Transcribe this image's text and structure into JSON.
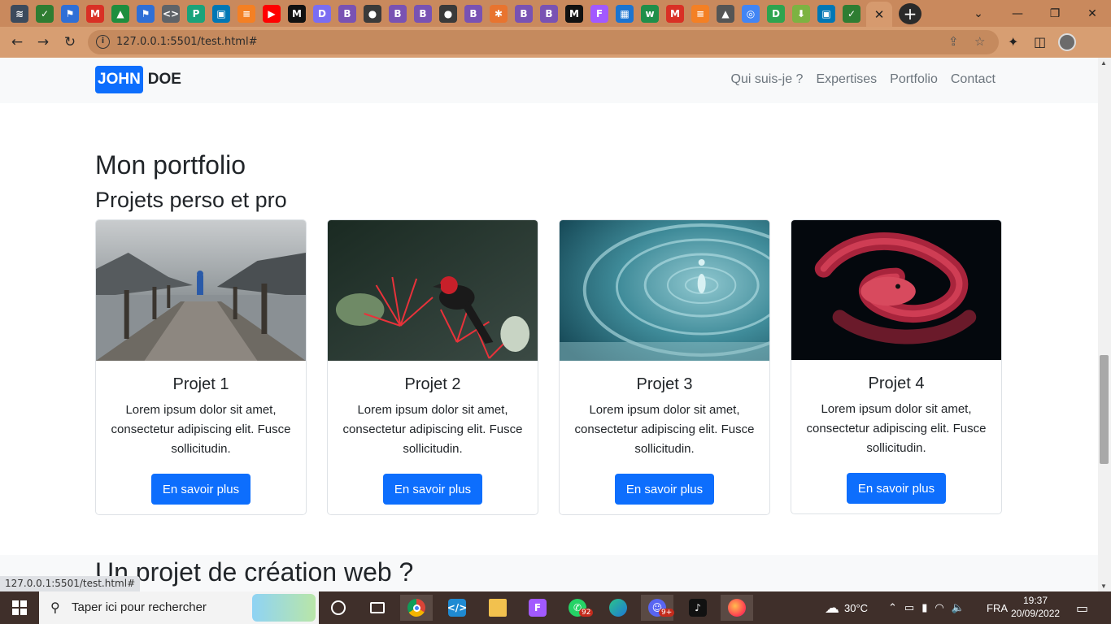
{
  "browser": {
    "url": "127.0.0.1:5501/test.html#",
    "status_url": "127.0.0.1:5501/test.html#",
    "tab_icons": [
      {
        "name": "layers-icon",
        "glyph": "≋",
        "color": "#3c4a5c"
      },
      {
        "name": "app-icon",
        "glyph": "✓",
        "color": "#2e7d32"
      },
      {
        "name": "flag-icon",
        "glyph": "⚑",
        "color": "#2f6fd6"
      },
      {
        "name": "gmail-icon",
        "glyph": "M",
        "color": "#d93025"
      },
      {
        "name": "drive-icon",
        "glyph": "▲",
        "color": "#1e8e3e"
      },
      {
        "name": "flag-icon",
        "glyph": "⚑",
        "color": "#2f6fd6"
      },
      {
        "name": "code-icon",
        "glyph": "<>",
        "color": "#5f6368"
      },
      {
        "name": "pen-icon",
        "glyph": "P",
        "color": "#1aa37a"
      },
      {
        "name": "screen-icon",
        "glyph": "▣",
        "color": "#0077b5"
      },
      {
        "name": "stack-icon",
        "glyph": "≡",
        "color": "#f48024"
      },
      {
        "name": "youtube-icon",
        "glyph": "▶",
        "color": "#ff0000"
      },
      {
        "name": "medium-icon",
        "glyph": "M",
        "color": "#111111"
      },
      {
        "name": "d-icon",
        "glyph": "D",
        "color": "#7a6df2"
      },
      {
        "name": "bootstrap-icon",
        "glyph": "B",
        "color": "#7952b3"
      },
      {
        "name": "github-icon",
        "glyph": "●",
        "color": "#3a3a3a"
      },
      {
        "name": "bootstrap-icon",
        "glyph": "B",
        "color": "#7952b3"
      },
      {
        "name": "bootstrap-icon",
        "glyph": "B",
        "color": "#7952b3"
      },
      {
        "name": "github-icon",
        "glyph": "●",
        "color": "#3a3a3a"
      },
      {
        "name": "bootstrap-icon",
        "glyph": "B",
        "color": "#7952b3"
      },
      {
        "name": "asterisk-icon",
        "glyph": "✱",
        "color": "#e8742f"
      },
      {
        "name": "bootstrap-icon",
        "glyph": "B",
        "color": "#7952b3"
      },
      {
        "name": "bootstrap-icon",
        "glyph": "B",
        "color": "#7952b3"
      },
      {
        "name": "medium-icon",
        "glyph": "M",
        "color": "#111111"
      },
      {
        "name": "figma-icon",
        "glyph": "F",
        "color": "#a259ff"
      },
      {
        "name": "window-icon",
        "glyph": "▦",
        "color": "#1b74d1"
      },
      {
        "name": "w-icon",
        "glyph": "w",
        "color": "#1f8f4a"
      },
      {
        "name": "gmail-icon",
        "glyph": "M",
        "color": "#d93025"
      },
      {
        "name": "stack-icon",
        "glyph": "≡",
        "color": "#f48024"
      },
      {
        "name": "fire-icon",
        "glyph": "▲",
        "color": "#555555"
      },
      {
        "name": "target-icon",
        "glyph": "◎",
        "color": "#4285f4"
      },
      {
        "name": "d-icon",
        "glyph": "D",
        "color": "#2ea44f"
      },
      {
        "name": "download-icon",
        "glyph": "⬇",
        "color": "#7cb342"
      },
      {
        "name": "screen-icon",
        "glyph": "▣",
        "color": "#0077b5"
      },
      {
        "name": "app-icon",
        "glyph": "✓",
        "color": "#2e7d32"
      }
    ],
    "active_tab_close": "✕",
    "new_tab": "+",
    "window_controls": {
      "dropdown": "⌄",
      "minimize": "—",
      "restore": "❐",
      "close": "✕"
    },
    "nav": {
      "back": "←",
      "forward": "→",
      "reload": "↻",
      "info": "i",
      "share": "⇪",
      "star": "☆",
      "extensions": "✦",
      "sidebar": "◫"
    }
  },
  "site": {
    "brand_first": "JOHN",
    "brand_last": "DOE",
    "nav_links": [
      "Qui suis-je ?",
      "Expertises",
      "Portfolio",
      "Contact"
    ],
    "title": "Mon portfolio",
    "subtitle": "Projets perso et pro",
    "next_heading": "Un projet de création web ?",
    "cards": [
      {
        "title": "Projet 1",
        "text": "Lorem ipsum dolor sit amet, consectetur adipiscing elit. Fusce sollicitudin.",
        "button": "En savoir plus",
        "image": "lake-pier-photo"
      },
      {
        "title": "Projet 2",
        "text": "Lorem ipsum dolor sit amet, consectetur adipiscing elit. Fusce sollicitudin.",
        "button": "En savoir plus",
        "image": "bird-flower-photo"
      },
      {
        "title": "Projet 3",
        "text": "Lorem ipsum dolor sit amet, consectetur adipiscing elit. Fusce sollicitudin.",
        "button": "En savoir plus",
        "image": "water-drop-photo"
      },
      {
        "title": "Projet 4",
        "text": "Lorem ipsum dolor sit amet, consectetur adipiscing elit. Fusce sollicitudin.",
        "button": "En savoir plus",
        "image": "red-snake-photo"
      }
    ],
    "colors": {
      "primary": "#0d6efd",
      "navbar_bg": "#f8f9fa",
      "text": "#212529",
      "muted": "#6c757d"
    }
  },
  "taskbar": {
    "search_placeholder": "Taper ici pour rechercher",
    "weather": "30°C",
    "language": "FRA",
    "time": "19:37",
    "date": "20/09/2022",
    "whatsapp_badge": "92",
    "discord_badge": "9+",
    "apps": [
      "cortana-icon",
      "task-view-icon",
      "chrome-icon",
      "vscode-icon",
      "file-explorer-icon",
      "figma-icon",
      "whatsapp-icon",
      "edge-icon",
      "discord-icon",
      "tiktok-icon",
      "firefox-icon"
    ]
  }
}
